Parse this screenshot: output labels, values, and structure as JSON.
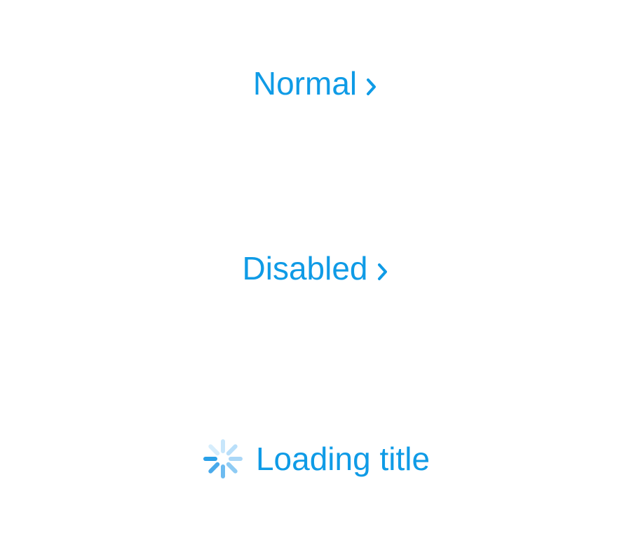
{
  "buttons": {
    "normal": {
      "label": "Normal",
      "icon": "chevron-right-icon",
      "state": "normal"
    },
    "disabled": {
      "label": "Disabled",
      "icon": "chevron-right-icon",
      "state": "disabled"
    },
    "loading": {
      "label": "Loading title",
      "icon": "spinner-icon",
      "state": "loading"
    }
  },
  "colors": {
    "accent": "#0f9be6",
    "background": "#ffffff"
  }
}
